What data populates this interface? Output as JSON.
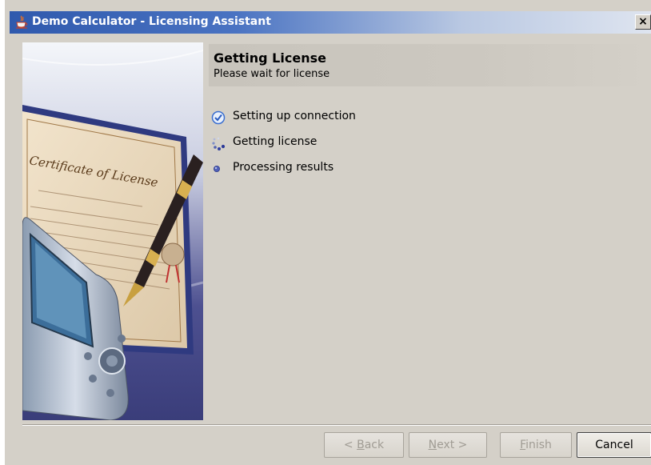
{
  "window": {
    "title": "Demo Calculator - Licensing Assistant",
    "close_label": "×"
  },
  "header": {
    "title": "Getting License",
    "subtitle": "Please wait for license"
  },
  "steps": [
    {
      "label": "Setting up connection",
      "state": "done",
      "icon": "check-circle-icon"
    },
    {
      "label": "Getting license",
      "state": "in-progress",
      "icon": "spinner-icon"
    },
    {
      "label": "Processing results",
      "state": "pending",
      "icon": "bullet-icon"
    }
  ],
  "buttons": {
    "back": {
      "prefix": "< ",
      "mnemonic": "B",
      "rest": "ack"
    },
    "next": {
      "mnemonic": "N",
      "rest": "ext >"
    },
    "finish": {
      "mnemonic": "F",
      "rest": "inish"
    },
    "cancel": "Cancel"
  },
  "colors": {
    "titlebar_start": "#2f59ad",
    "dialog_bg": "#d4d0c8",
    "check_blue": "#3b6fd0"
  }
}
